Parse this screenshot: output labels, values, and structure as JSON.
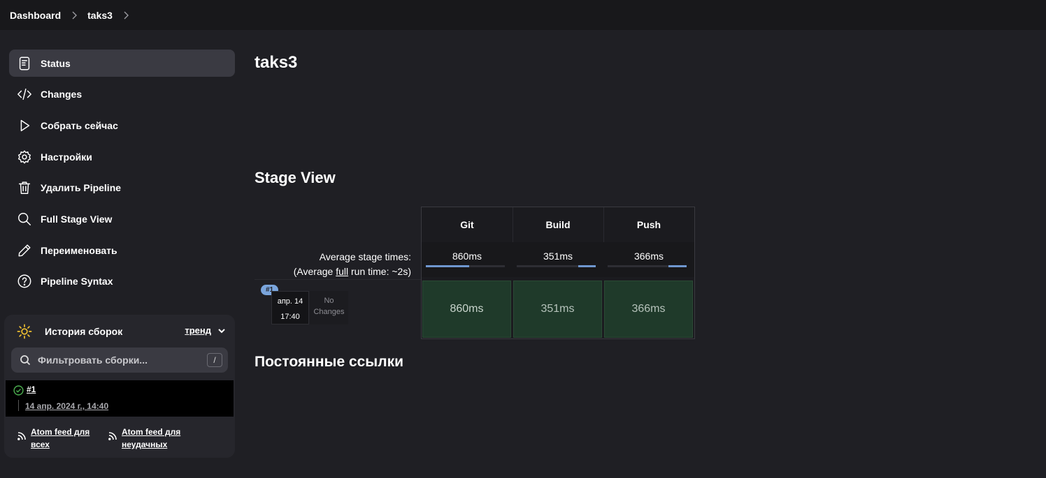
{
  "breadcrumb": {
    "items": [
      "Dashboard",
      "taks3"
    ]
  },
  "sidebar": {
    "items": [
      {
        "label": "Status",
        "icon": "document-icon",
        "active": true
      },
      {
        "label": "Changes",
        "icon": "code-icon"
      },
      {
        "label": "Собрать сейчас",
        "icon": "play-icon"
      },
      {
        "label": "Настройки",
        "icon": "gear-icon"
      },
      {
        "label": "Удалить Pipeline",
        "icon": "trash-icon"
      },
      {
        "label": "Full Stage View",
        "icon": "search-icon"
      },
      {
        "label": "Переименовать",
        "icon": "pencil-icon"
      },
      {
        "label": "Pipeline Syntax",
        "icon": "help-icon"
      }
    ]
  },
  "history": {
    "title": "История сборок",
    "trend_label": "тренд",
    "filter_placeholder": "Фильтровать сборки...",
    "filter_shortcut": "/",
    "builds": [
      {
        "number": "#1",
        "date": "14 апр. 2024 г., 14:40",
        "status": "success"
      }
    ],
    "feeds": {
      "all": "Atom feed для всех",
      "failed": "Atom feed для неудачных"
    }
  },
  "main": {
    "title": "taks3",
    "stage_view_title": "Stage View",
    "permalinks_title": "Постоянные ссылки"
  },
  "stage_view": {
    "avg_label_line1": "Average stage times:",
    "avg_label_pre": "(Average ",
    "avg_label_link": "full",
    "avg_label_post": " run time: ~2s)",
    "stages": [
      {
        "name": "Git",
        "avg": "860ms",
        "avg_fraction": 0.55,
        "align": "left",
        "run_value": "860ms"
      },
      {
        "name": "Build",
        "avg": "351ms",
        "avg_fraction": 0.22,
        "align": "right",
        "run_value": "351ms"
      },
      {
        "name": "Push",
        "avg": "366ms",
        "avg_fraction": 0.23,
        "align": "right",
        "run_value": "366ms"
      }
    ],
    "run": {
      "badge": "#1",
      "date": "апр. 14",
      "time": "17:40",
      "changes": "No Changes"
    }
  },
  "colors": {
    "success": "#4caf50",
    "stage_cell": "#1f3a2a",
    "avg_bar": "#6f97d0",
    "badge": "#7aa5dc"
  }
}
